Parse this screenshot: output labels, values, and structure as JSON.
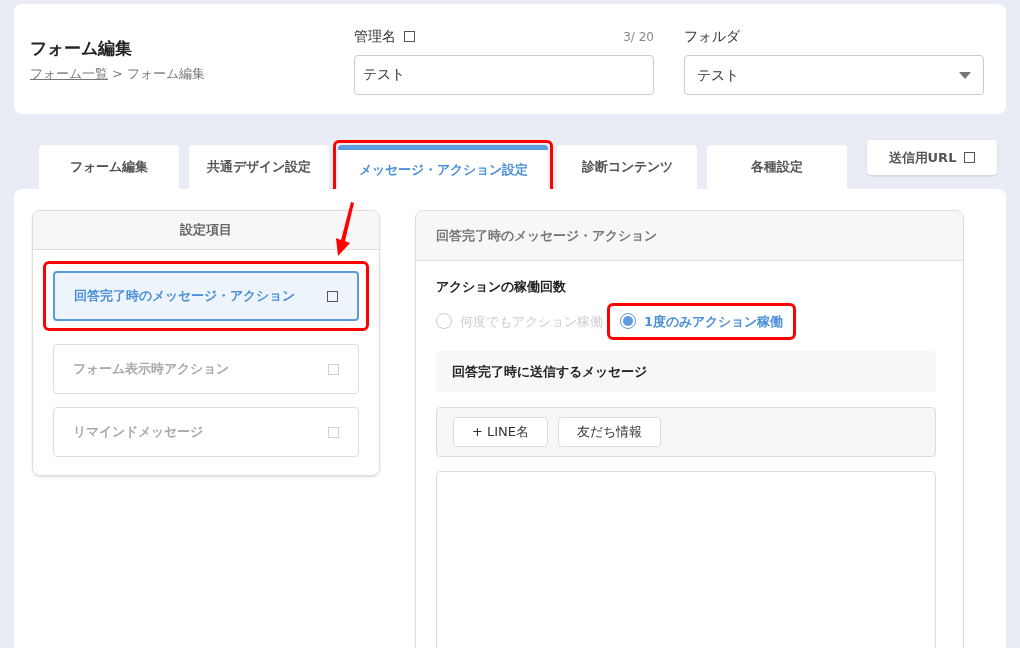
{
  "header": {
    "title": "フォーム編集",
    "breadcrumb": {
      "link": "フォーム一覧",
      "separator": ">",
      "current": "フォーム編集"
    },
    "name_field": {
      "label": "管理名",
      "value": "テスト",
      "counter": "3/ 20"
    },
    "folder_field": {
      "label": "フォルダ",
      "value": "テスト"
    }
  },
  "tabs": [
    {
      "label": "フォーム編集",
      "selected": false,
      "highlighted": false
    },
    {
      "label": "共通デザイン設定",
      "selected": false,
      "highlighted": false
    },
    {
      "label": "メッセージ・アクション設定",
      "selected": true,
      "highlighted": true
    },
    {
      "label": "診断コンテンツ",
      "selected": false,
      "highlighted": false
    },
    {
      "label": "各種設定",
      "selected": false,
      "highlighted": false
    }
  ],
  "url_button": "送信用URL",
  "settings": {
    "title": "設定項目",
    "items": [
      {
        "label": "回答完了時のメッセージ・アクション",
        "selected": true,
        "highlighted": true
      },
      {
        "label": "フォーム表示時アクション",
        "selected": false,
        "highlighted": false
      },
      {
        "label": "リマインドメッセージ",
        "selected": false,
        "highlighted": false
      }
    ]
  },
  "detail": {
    "title": "回答完了時のメッセージ・アクション",
    "run_count_label": "アクションの稼働回数",
    "radios": [
      {
        "label": "何度でもアクション稼働",
        "selected": false,
        "highlighted": false
      },
      {
        "label": "1度のみアクション稼働",
        "selected": true,
        "highlighted": true
      }
    ],
    "message_heading": "回答完了時に送信するメッセージ",
    "insert_buttons": [
      "+ LINE名",
      "友だち情報"
    ]
  }
}
